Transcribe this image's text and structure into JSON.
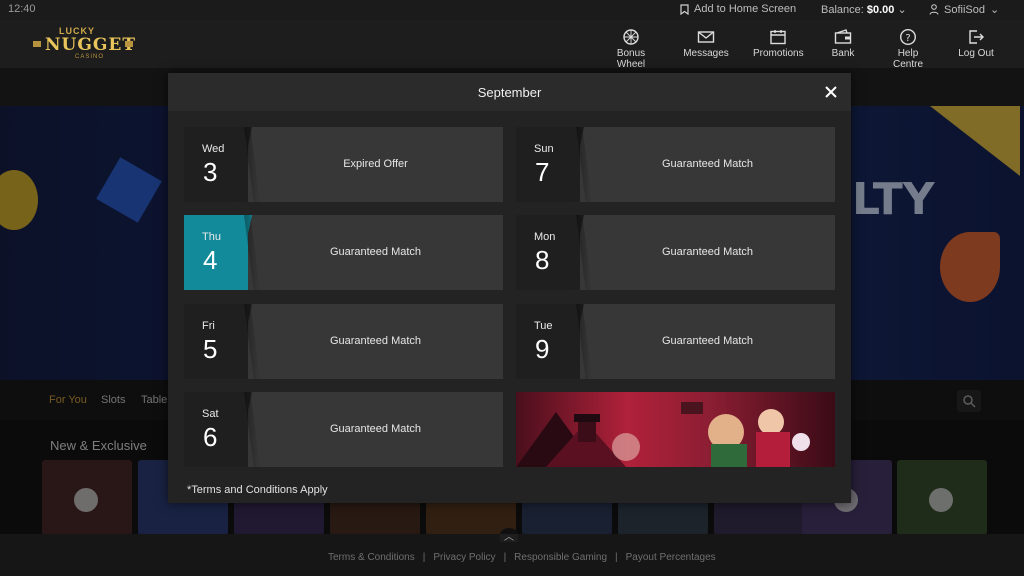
{
  "status_bar": {
    "time": "12:40"
  },
  "top": {
    "add_home": "Add to Home Screen",
    "balance_label": "Balance:",
    "balance_value": "$0.00",
    "username": "SofiiSod"
  },
  "logo": {
    "line1": "LUCKY",
    "line2": "NUGGET",
    "line3": "CASINO"
  },
  "nav": [
    {
      "label": "Bonus Wheel",
      "icon": "wheel-icon"
    },
    {
      "label": "Messages",
      "icon": "envelope-icon"
    },
    {
      "label": "Promotions",
      "icon": "calendar-icon"
    },
    {
      "label": "Bank",
      "icon": "wallet-icon"
    },
    {
      "label": "Help Centre",
      "icon": "help-icon"
    },
    {
      "label": "Log Out",
      "icon": "logout-icon"
    }
  ],
  "hero": {
    "right_text": "LTY"
  },
  "tabs": {
    "for_you": "For You",
    "slots": "Slots",
    "table": "Table"
  },
  "section": {
    "title": "New & Exclusive"
  },
  "footer": {
    "terms": "Terms & Conditions",
    "privacy": "Privacy Policy",
    "responsible": "Responsible Gaming",
    "payout": "Payout Percentages",
    "sep": "|"
  },
  "modal": {
    "title": "September",
    "terms": "*Terms and Conditions Apply",
    "days": [
      {
        "dow": "Wed",
        "num": "3",
        "offer": "Expired Offer",
        "today": false
      },
      {
        "dow": "Sun",
        "num": "7",
        "offer": "Guaranteed Match",
        "today": false
      },
      {
        "dow": "Thu",
        "num": "4",
        "offer": "Guaranteed Match",
        "today": true
      },
      {
        "dow": "Mon",
        "num": "8",
        "offer": "Guaranteed Match",
        "today": false
      },
      {
        "dow": "Fri",
        "num": "5",
        "offer": "Guaranteed Match",
        "today": false
      },
      {
        "dow": "Tue",
        "num": "9",
        "offer": "Guaranteed Match",
        "today": false
      },
      {
        "dow": "Sat",
        "num": "6",
        "offer": "Guaranteed Match",
        "today": false
      }
    ]
  },
  "colors": {
    "accent": "#d8a33c",
    "today": "#128a9a",
    "card": "#373737"
  }
}
